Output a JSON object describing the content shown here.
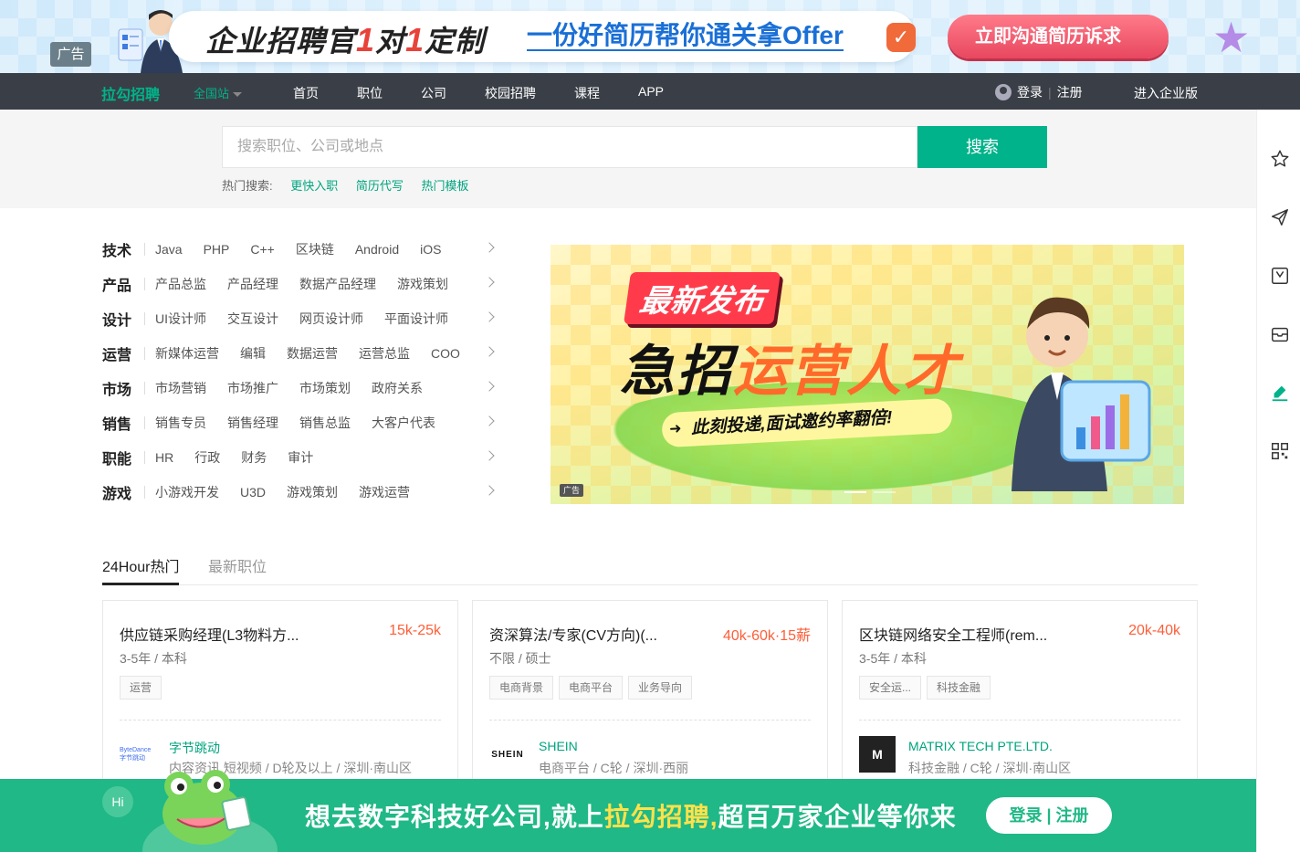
{
  "top_ad": {
    "tag": "广告",
    "headline_part1": "企业招聘官",
    "headline_num1": "1",
    "headline_mid": "对",
    "headline_num2": "1",
    "headline_part2": "定制",
    "subline": "一份好简历帮你通关拿Offer",
    "cta": "立即沟通简历诉求",
    "check_icon": "check-icon",
    "star_icon": "star-icon"
  },
  "nav": {
    "logo": "拉勾招聘",
    "city": "全国站",
    "menu": [
      "首页",
      "职位",
      "公司",
      "校园招聘",
      "课程",
      "APP"
    ],
    "login": "登录",
    "register": "注册",
    "separator": "|",
    "enterprise": "进入企业版"
  },
  "search": {
    "placeholder": "搜索职位、公司或地点",
    "value": "",
    "button": "搜索",
    "hot_label": "热门搜索:",
    "hot_items": [
      "更快入职",
      "简历代写",
      "热门模板"
    ]
  },
  "right_bar": [
    "star-icon",
    "send-icon",
    "bookmark-icon",
    "inbox-icon",
    "edit-icon",
    "qrcode-icon"
  ],
  "categories": [
    {
      "head": "技术",
      "items": [
        "Java",
        "PHP",
        "C++",
        "区块链",
        "Android",
        "iOS"
      ]
    },
    {
      "head": "产品",
      "items": [
        "产品总监",
        "产品经理",
        "数据产品经理",
        "游戏策划"
      ]
    },
    {
      "head": "设计",
      "items": [
        "UI设计师",
        "交互设计",
        "网页设计师",
        "平面设计师"
      ]
    },
    {
      "head": "运营",
      "items": [
        "新媒体运营",
        "编辑",
        "数据运营",
        "运营总监",
        "COO"
      ]
    },
    {
      "head": "市场",
      "items": [
        "市场营销",
        "市场推广",
        "市场策划",
        "政府关系"
      ]
    },
    {
      "head": "销售",
      "items": [
        "销售专员",
        "销售经理",
        "销售总监",
        "大客户代表"
      ]
    },
    {
      "head": "职能",
      "items": [
        "HR",
        "行政",
        "财务",
        "审计"
      ]
    },
    {
      "head": "游戏",
      "items": [
        "小游戏开发",
        "U3D",
        "游戏策划",
        "游戏运营"
      ]
    }
  ],
  "hero": {
    "tag": "最新发布",
    "title_a": "急招",
    "title_b": "运营人才",
    "strip": "此刻投递,面试邀约率翻倍!",
    "ad": "广告"
  },
  "tabs": [
    "24Hour热门",
    "最新职位"
  ],
  "jobs": [
    {
      "title": "供应链采购经理(L3物料方...",
      "salary": "15k-25k",
      "req": "3-5年 / 本科",
      "tags": [
        "运营"
      ],
      "company": "字节跳动",
      "info": "内容资讯,短视频 / D轮及以上 / 深圳·南山区",
      "logo": "ByteDance 字节跳动",
      "logo_color": "#3c6df0"
    },
    {
      "title": "资深算法/专家(CV方向)(...",
      "salary": "40k-60k·15薪",
      "req": "不限 / 硕士",
      "tags": [
        "电商背景",
        "电商平台",
        "业务导向"
      ],
      "company": "SHEIN",
      "info": "电商平台 / C轮 / 深圳·西丽",
      "logo": "SHEIN",
      "logo_color": "#111111"
    },
    {
      "title": "区块链网络安全工程师(rem...",
      "salary": "20k-40k",
      "req": "3-5年 / 本科",
      "tags": [
        "安全运...",
        "科技金融"
      ],
      "company": "MATRIX TECH PTE.LTD.",
      "info": "科技金融 / C轮 / 深圳·南山区",
      "logo": "M",
      "logo_color": "#222222"
    }
  ],
  "bottom": {
    "hi": "Hi",
    "slogan_a": "想去数字科技好公司,就上",
    "slogan_b": "拉勾招聘,",
    "slogan_c": "超百万家企业等你来",
    "login": "登录",
    "sep": "|",
    "register": "注册"
  },
  "colors": {
    "accent": "#00b38a",
    "salary": "#fd5f39",
    "nav_bg": "#3a3f47",
    "bottom_bg": "#1fb886"
  }
}
